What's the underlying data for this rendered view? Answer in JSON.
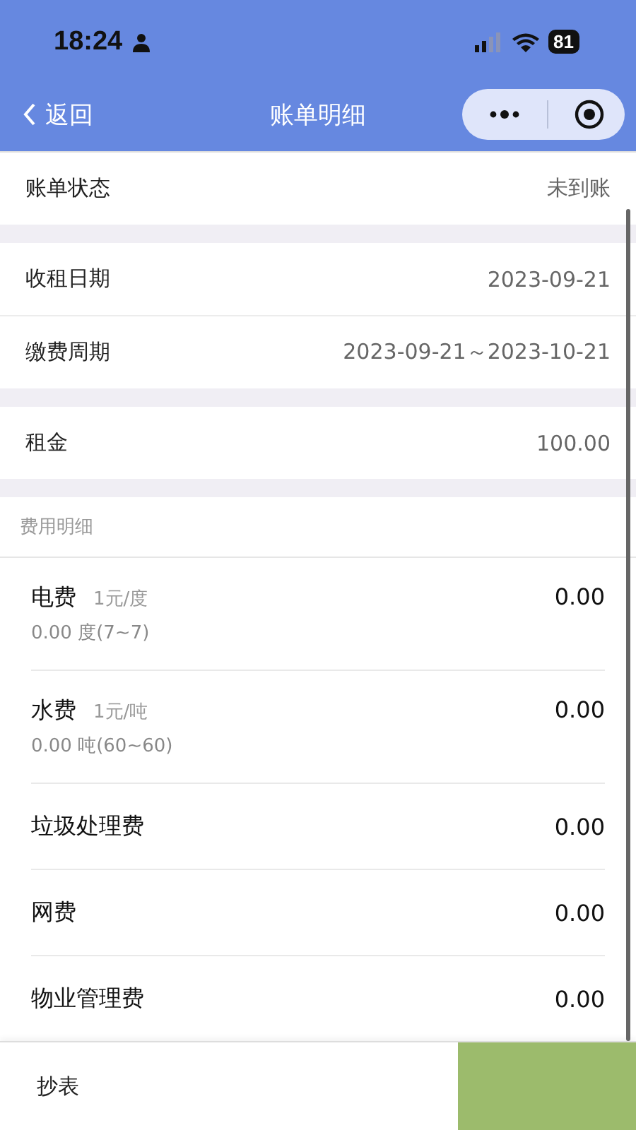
{
  "status_bar": {
    "time": "18:24",
    "battery": "81"
  },
  "nav": {
    "back": "返回",
    "title": "账单明细"
  },
  "groups": [
    [
      {
        "label": "账单状态",
        "value": "未到账"
      }
    ],
    [
      {
        "label": "收租日期",
        "value": "2023-09-21"
      },
      {
        "label": "缴费周期",
        "value": "2023-09-21～2023-10-21"
      }
    ],
    [
      {
        "label": "租金",
        "value": "100.00"
      }
    ]
  ],
  "fees": {
    "heading": "费用明细",
    "items": [
      {
        "kind": "metered",
        "name": "电费",
        "rate": "1元/度",
        "usage": "0.00 度(7~7)",
        "amount": "0.00"
      },
      {
        "kind": "metered",
        "name": "水费",
        "rate": "1元/吨",
        "usage": "0.00 吨(60~60)",
        "amount": "0.00"
      },
      {
        "kind": "flat",
        "name": "垃圾处理费",
        "amount": "0.00"
      },
      {
        "kind": "flat",
        "name": "网费",
        "amount": "0.00"
      },
      {
        "kind": "flat",
        "name": "物业管理费",
        "amount": "0.00"
      }
    ]
  },
  "bottom_bar": {
    "left": "抄表"
  }
}
